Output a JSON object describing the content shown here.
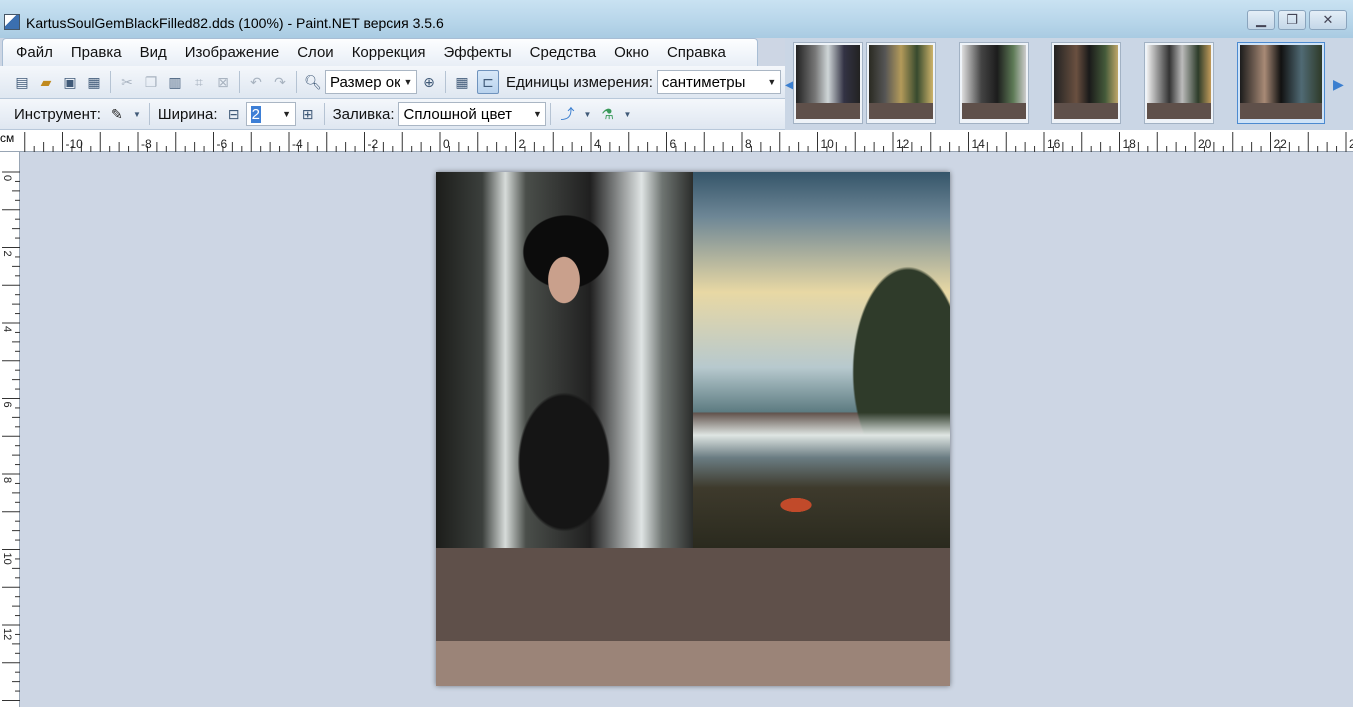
{
  "window": {
    "title": "KartusSoulGemBlackFilled82.dds (100%) - Paint.NET версия 3.5.6",
    "minimize_glyph": "▁",
    "maximize_glyph": "❐",
    "close_glyph": "✕"
  },
  "menu": {
    "items": [
      {
        "label": "Файл"
      },
      {
        "label": "Правка"
      },
      {
        "label": "Вид"
      },
      {
        "label": "Изображение"
      },
      {
        "label": "Слои"
      },
      {
        "label": "Коррекция"
      },
      {
        "label": "Эффекты"
      },
      {
        "label": "Средства"
      },
      {
        "label": "Окно"
      },
      {
        "label": "Справка"
      }
    ]
  },
  "toolbar": {
    "icons": [
      "new-file-icon",
      "open-file-icon",
      "save-icon",
      "print-icon",
      "cut-icon",
      "copy-icon",
      "paste-icon",
      "crop-icon",
      "deselect-icon",
      "undo-icon",
      "redo-icon",
      "zoom-out-icon"
    ],
    "zoom_value": "Размер ок",
    "units_label": "Единицы измерения:",
    "units_value": "сантиметры"
  },
  "toolbar2": {
    "tool_label": "Инструмент:",
    "width_label": "Ширина:",
    "width_value": "2",
    "fill_label": "Заливка:",
    "fill_value": "Сплошной цвет"
  },
  "thumbnails": {
    "count": 6,
    "selected_index": 5
  },
  "ruler": {
    "unit": "см",
    "h_labels": [
      "-10",
      "-8",
      "-6",
      "-4",
      "-2",
      "0",
      "2",
      "4",
      "6",
      "8",
      "10",
      "12",
      "14",
      "16",
      "18",
      "20",
      "22",
      "2"
    ],
    "v_labels": [
      "0",
      "2",
      "4",
      "6",
      "8",
      "10",
      "12"
    ]
  },
  "colors": {
    "workspace": "#cdd6e4",
    "image_base": "#5f504a",
    "image_floor": "#9b8478",
    "accent": "#3d7fd6"
  }
}
